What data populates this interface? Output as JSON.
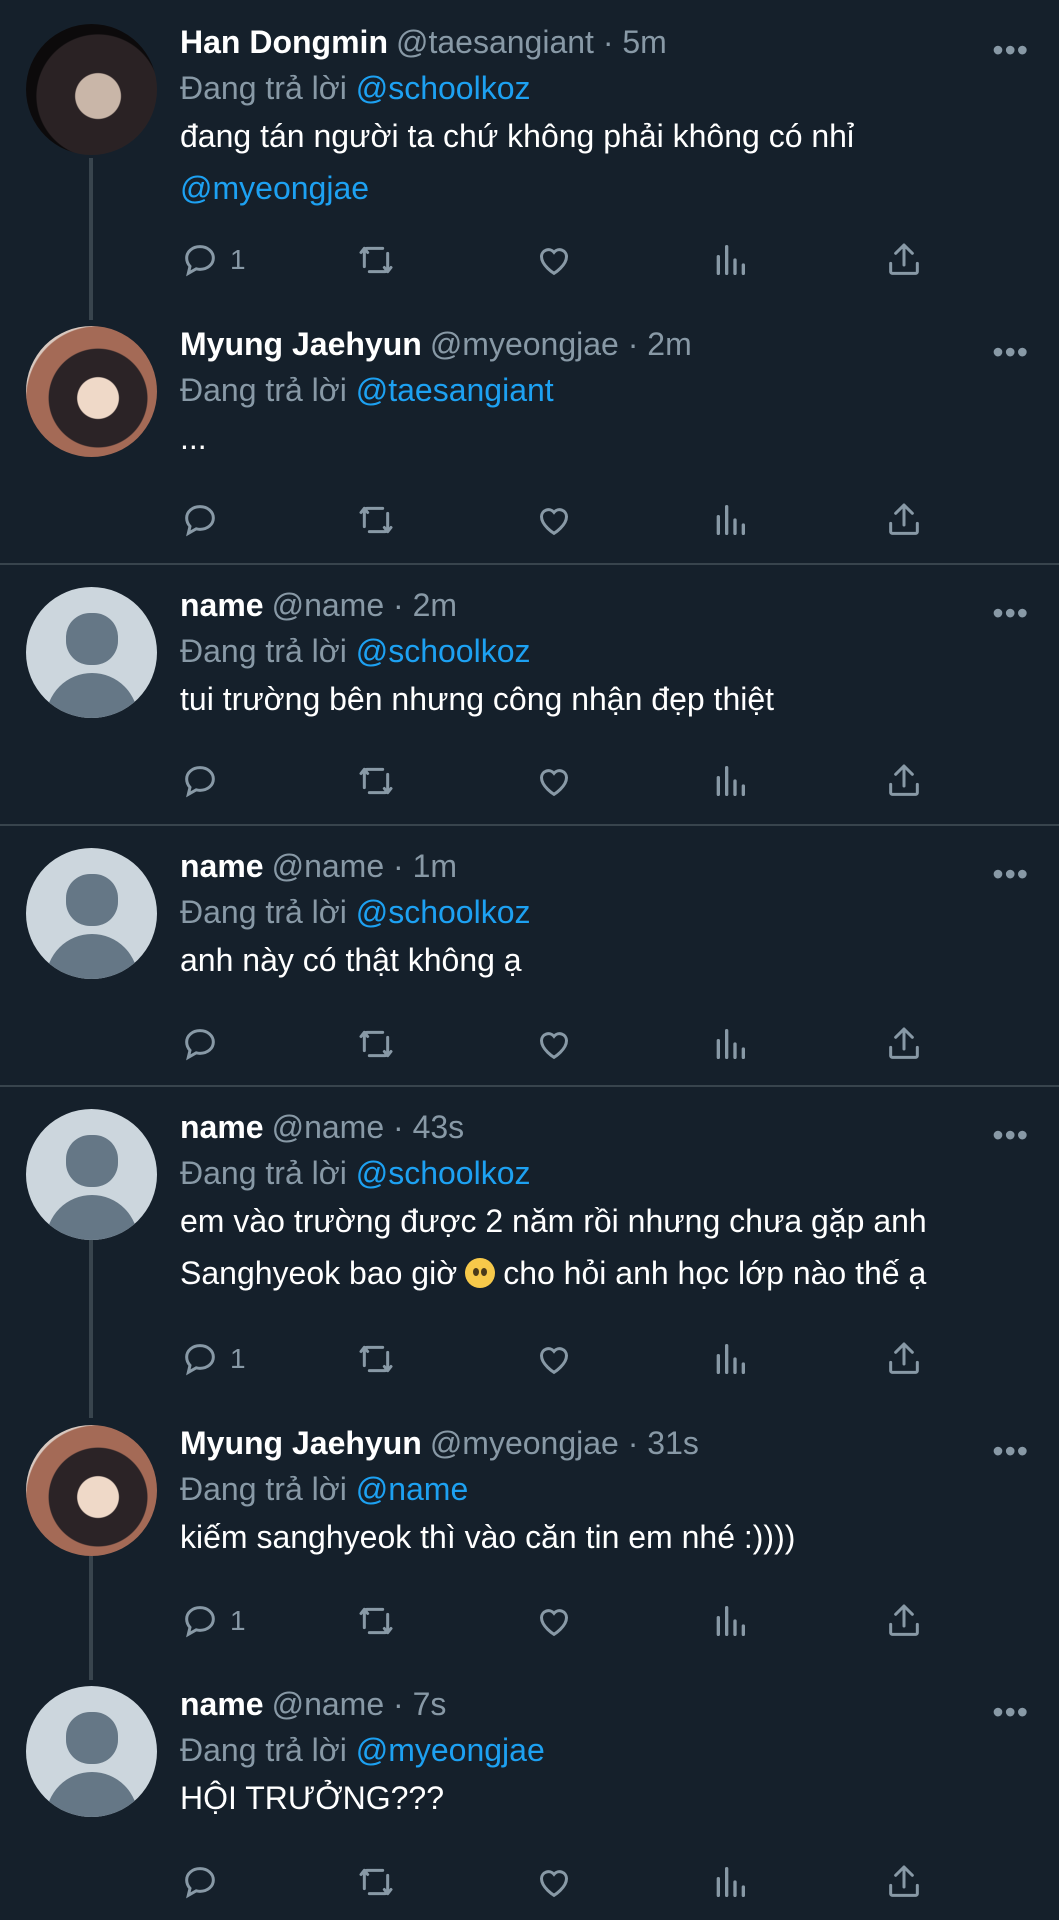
{
  "reply_prefix": "Đang trả lời",
  "tweets": [
    {
      "name": "Han Dongmin",
      "meta": "@taesangiant · 5m",
      "reply_to": "@schoolkoz",
      "text_line1": "đang tán người ta chứ không phải không có nhỉ",
      "text_line2": "@myeongjae",
      "reply_count": "1",
      "avatar": "photo"
    },
    {
      "name": "Myung Jaehyun",
      "meta": "@myeongjae · 2m",
      "reply_to": "@taesangiant",
      "text_line1": "...",
      "reply_count": "",
      "avatar": "photo"
    },
    {
      "name": "name",
      "meta": "@name · 2m",
      "reply_to": "@schoolkoz",
      "text_line1": "tui trường bên nhưng công nhận đẹp thiệt",
      "reply_count": "",
      "avatar": "default"
    },
    {
      "name": "name",
      "meta": "@name · 1m",
      "reply_to": "@schoolkoz",
      "text_line1": "anh này có thật không ạ",
      "reply_count": "",
      "avatar": "default"
    },
    {
      "name": "name",
      "meta": "@name · 43s",
      "reply_to": "@schoolkoz",
      "text_line1": "em vào trường được 2 năm rồi nhưng chưa gặp anh",
      "text_line2a": "Sanghyeok bao giờ",
      "emoji": "pleading-face-emoji",
      "text_line2b": "cho hỏi anh học lớp nào thế ạ",
      "reply_count": "1",
      "avatar": "default"
    },
    {
      "name": "Myung Jaehyun",
      "meta": "@myeongjae · 31s",
      "reply_to": "@name",
      "text_line1": "kiếm sanghyeok thì vào căn tin em nhé :))))",
      "reply_count": "1",
      "avatar": "photo"
    },
    {
      "name": "name",
      "meta": "@name · 7s",
      "reply_to": "@myeongjae",
      "text_line1": "HỘI TRƯỞNG???",
      "reply_count": "",
      "avatar": "default"
    }
  ],
  "more_label": "•••",
  "colors": {
    "background": "#15202b",
    "muted": "#8899a6",
    "accent": "#1da1f2",
    "divider": "#38444d"
  }
}
